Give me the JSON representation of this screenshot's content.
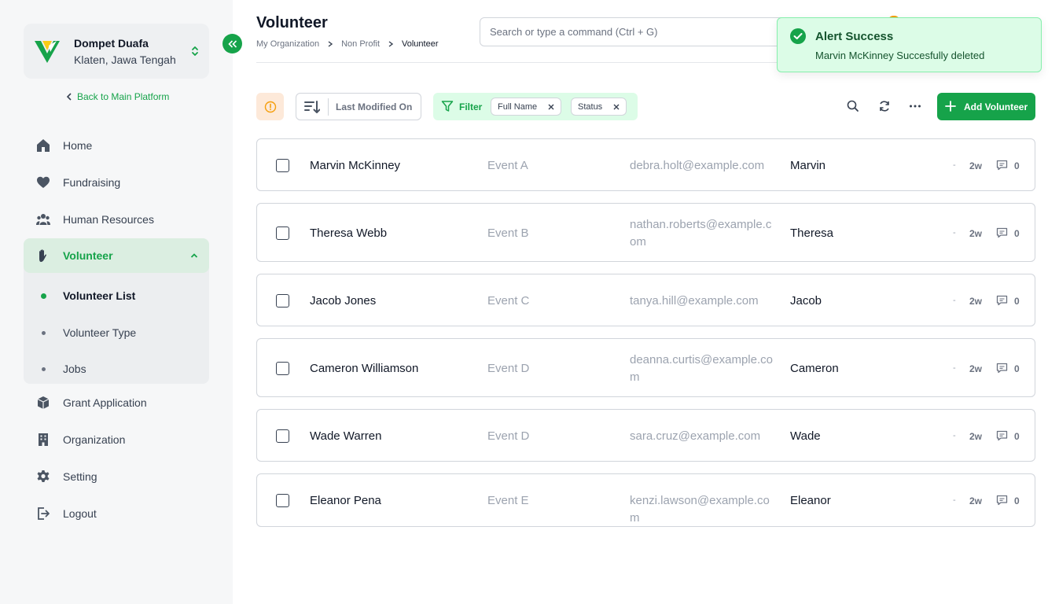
{
  "org": {
    "name": "Dompet Duafa",
    "location": "Klaten, Jawa Tengah",
    "back_label": "Back to Main Platform"
  },
  "nav": {
    "home": "Home",
    "fundraising": "Fundraising",
    "hr": "Human Resources",
    "volunteer": "Volunteer",
    "volunteer_list": "Volunteer List",
    "volunteer_type": "Volunteer Type",
    "jobs": "Jobs",
    "grant": "Grant Application",
    "organization": "Organization",
    "setting": "Setting",
    "logout": "Logout"
  },
  "header": {
    "title": "Volunteer",
    "breadcrumb": [
      "My Organization",
      "Non Profit",
      "Volunteer"
    ],
    "search_placeholder": "Search or type a command (Ctrl + G)"
  },
  "toast": {
    "title": "Alert Success",
    "message": "Marvin McKinney Succesfully deleted"
  },
  "toolbar": {
    "sort_label": "Last Modified On",
    "filter_label": "Filter",
    "chips": [
      "Full Name",
      "Status"
    ],
    "add_label": "Add Volunteer"
  },
  "rows": [
    {
      "name": "Marvin McKinney",
      "event": "Event A",
      "email": "debra.holt@example.com",
      "first": "Marvin",
      "dash": "-",
      "age": "2w",
      "comments": "0"
    },
    {
      "name": "Theresa Webb",
      "event": "Event B",
      "email": "nathan.roberts@example.com",
      "first": "Theresa",
      "dash": "-",
      "age": "2w",
      "comments": "0"
    },
    {
      "name": "Jacob Jones",
      "event": "Event C",
      "email": "tanya.hill@example.com",
      "first": "Jacob",
      "dash": "-",
      "age": "2w",
      "comments": "0"
    },
    {
      "name": "Cameron Williamson",
      "event": "Event D",
      "email": "deanna.curtis@example.com",
      "first": "Cameron",
      "dash": "-",
      "age": "2w",
      "comments": "0"
    },
    {
      "name": "Wade Warren",
      "event": "Event D",
      "email": "sara.cruz@example.com",
      "first": "Wade",
      "dash": "-",
      "age": "2w",
      "comments": "0"
    },
    {
      "name": "Eleanor Pena",
      "event": "Event E",
      "email": "kenzi.lawson@example.com",
      "first": "Eleanor",
      "dash": "-",
      "age": "2w",
      "comments": "0"
    }
  ],
  "colors": {
    "accent": "#16a34a",
    "toast_bg": "#dcfce7",
    "warn_bg": "#fde9d9"
  },
  "icons": [
    "home-icon",
    "heart-icon",
    "people-icon",
    "hand-icon",
    "box-icon",
    "building-icon",
    "gear-icon",
    "logout-icon",
    "search-icon",
    "refresh-icon",
    "more-icon",
    "plus-icon",
    "filter-icon",
    "sort-icon",
    "alert-icon",
    "check-circle-icon",
    "comment-icon"
  ]
}
